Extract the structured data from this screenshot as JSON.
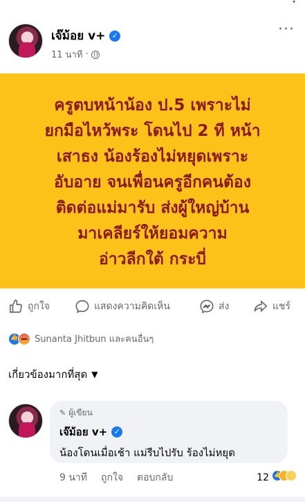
{
  "post": {
    "author": "เจ๊ม้อย v+",
    "time": "11 นาที",
    "card_lines": [
      "ครูตบหน้าน้อง ป.5 เพราะไม่",
      "ยกมือไหว้พระ โดนไป 2 ที หน้า",
      "เสาธง น้องร้องไม่หยุดเพราะ",
      "อับอาย จนเพื่อนครูอีกคนต้อง",
      "ติดต่อแม่มารับ ส่งผู้ใหญ่บ้าน",
      "มาเคลียร์ให้ยอมความ",
      "อ่าวลีกใต้ กระบี่"
    ],
    "card_bg": "#fcc21a",
    "card_text_color": "#8a1a1a"
  },
  "actions": {
    "like": "ถูกใจ",
    "comment": "แสดงความคิดเห็น",
    "send": "ส่ง",
    "share": "แชร์"
  },
  "reactions": {
    "text": "Sunanta Jhitbun และคนอื่นๆ",
    "icons": [
      "like-icon",
      "angry-icon"
    ]
  },
  "sort_label": "เกี่ยวข้องมากที่สุด",
  "comment": {
    "badge": "ผู้เขียน",
    "author": "เจ๊ม้อย v+",
    "text": "น้องโดนเมื่อเช้า แม่รีบไปรับ ร้องไม่หยุด",
    "time": "9 นาที",
    "like": "ถูกใจ",
    "reply": "ตอบกลับ",
    "reaction_count": "12",
    "reaction_icons": [
      "like-icon",
      "haha-icon",
      "sad-icon"
    ]
  },
  "colors": {
    "verified": "#1877f2",
    "secondary_text": "#65676b"
  }
}
